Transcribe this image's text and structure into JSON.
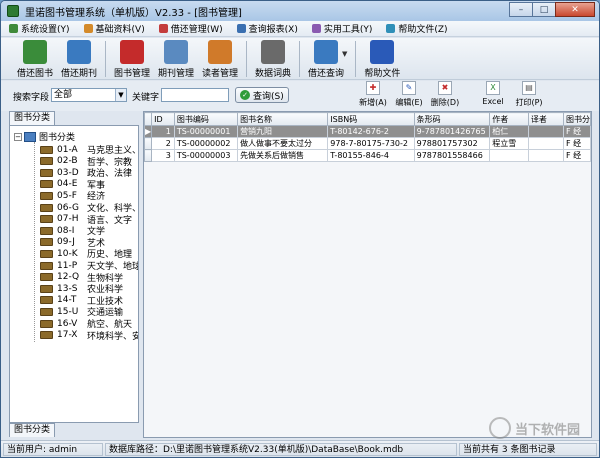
{
  "window": {
    "title": "里诺图书管理系统（单机版）V2.33 - [图书管理]",
    "minimize": "–",
    "maximize": "□",
    "close": "✕"
  },
  "menu": [
    {
      "label": "系统设置(Y)",
      "color": "#3f8a3a"
    },
    {
      "label": "基础资料(V)",
      "color": "#d48a2a"
    },
    {
      "label": "借还管理(W)",
      "color": "#c43c3c"
    },
    {
      "label": "查询报表(X)",
      "color": "#3a6fb0"
    },
    {
      "label": "实用工具(Y)",
      "color": "#8a5ab0"
    },
    {
      "label": "帮助文件(Z)",
      "color": "#2f8fb8"
    }
  ],
  "toolbar": [
    {
      "label": "借还图书",
      "icon": "book-person-icon",
      "color": "#3a8c3a"
    },
    {
      "label": "借还期刊",
      "icon": "magazine-icon",
      "color": "#3a7ac0"
    },
    {
      "label": "图书管理",
      "icon": "red-book-icon",
      "color": "#c42b2b"
    },
    {
      "label": "期刊管理",
      "icon": "periodical-icon",
      "color": "#5a8ac0"
    },
    {
      "label": "读者管理",
      "icon": "reader-icon",
      "color": "#d07a2a"
    },
    {
      "label": "数据词典",
      "icon": "dictionary-icon",
      "color": "#6a6a6a"
    },
    {
      "label": "借还查询",
      "icon": "magnifier-icon",
      "color": "#3a7ac0"
    },
    {
      "label": "帮助文件",
      "icon": "help-icon",
      "color": "#2a5ab8"
    }
  ],
  "search": {
    "field_label": "搜索字段",
    "field_value": "全部",
    "keyword_label": "关键字",
    "keyword_value": "",
    "query_button": "查询(S)"
  },
  "actions": [
    {
      "label": "新增(A)",
      "icon": "add-icon",
      "glyph": "✚",
      "color": "#c42b2b"
    },
    {
      "label": "编辑(E)",
      "icon": "edit-icon",
      "glyph": "✎",
      "color": "#2a5ab8"
    },
    {
      "label": "删除(D)",
      "icon": "delete-icon",
      "glyph": "✖",
      "color": "#c42b2b"
    },
    {
      "label": "Excel",
      "icon": "excel-icon",
      "glyph": "X",
      "color": "#2f8a3a"
    },
    {
      "label": "打印(P)",
      "icon": "print-icon",
      "glyph": "▤",
      "color": "#555555"
    }
  ],
  "tree": {
    "top_tab": "图书分类",
    "bottom_tab": "图书分类",
    "root_label": "图书分类",
    "nodes": [
      {
        "code": "01-A",
        "name": "马克思主义、列"
      },
      {
        "code": "02-B",
        "name": "哲学、宗教"
      },
      {
        "code": "03-D",
        "name": "政治、法律"
      },
      {
        "code": "04-E",
        "name": "军事"
      },
      {
        "code": "05-F",
        "name": "经济"
      },
      {
        "code": "06-G",
        "name": "文化、科学、教"
      },
      {
        "code": "07-H",
        "name": "语言、文字"
      },
      {
        "code": "08-I",
        "name": "文学"
      },
      {
        "code": "09-J",
        "name": "艺术"
      },
      {
        "code": "10-K",
        "name": "历史、地理"
      },
      {
        "code": "11-P",
        "name": "天文学、地球科"
      },
      {
        "code": "12-Q",
        "name": "生物科学"
      },
      {
        "code": "13-S",
        "name": "农业科学"
      },
      {
        "code": "14-T",
        "name": "工业技术"
      },
      {
        "code": "15-U",
        "name": "交通运输"
      },
      {
        "code": "16-V",
        "name": "航空、航天"
      },
      {
        "code": "17-X",
        "name": "环境科学、安全"
      }
    ]
  },
  "grid": {
    "columns": [
      "ID",
      "图书编码",
      "图书名称",
      "ISBN码",
      "条形码",
      "作者",
      "译者",
      "图书分"
    ],
    "rows": [
      {
        "id": "1",
        "code": "TS-00000001",
        "name": "营销九阳",
        "isbn": "T-80142-676-2",
        "barcode": "9-787801426765",
        "author": "柏仁",
        "translator": "",
        "cat": "F 经",
        "selected": true
      },
      {
        "id": "2",
        "code": "TS-00000002",
        "name": "做人做事不要太过分",
        "isbn": "978-7-80175-730-2",
        "barcode": "978801757302",
        "author": "程立雪",
        "translator": "",
        "cat": "F 经",
        "selected": false
      },
      {
        "id": "3",
        "code": "TS-00000003",
        "name": "先做关系后做销售",
        "isbn": "T-80155-846-4",
        "barcode": "9787801558466",
        "author": "",
        "translator": "",
        "cat": "F 经",
        "selected": false
      }
    ]
  },
  "status": {
    "user": "当前用户: admin",
    "db_path": "数据库路径：D:\\里诺图书管理系统V2.33(单机版)\\DataBase\\Book.mdb",
    "count": "当前共有 3 条图书记录"
  }
}
